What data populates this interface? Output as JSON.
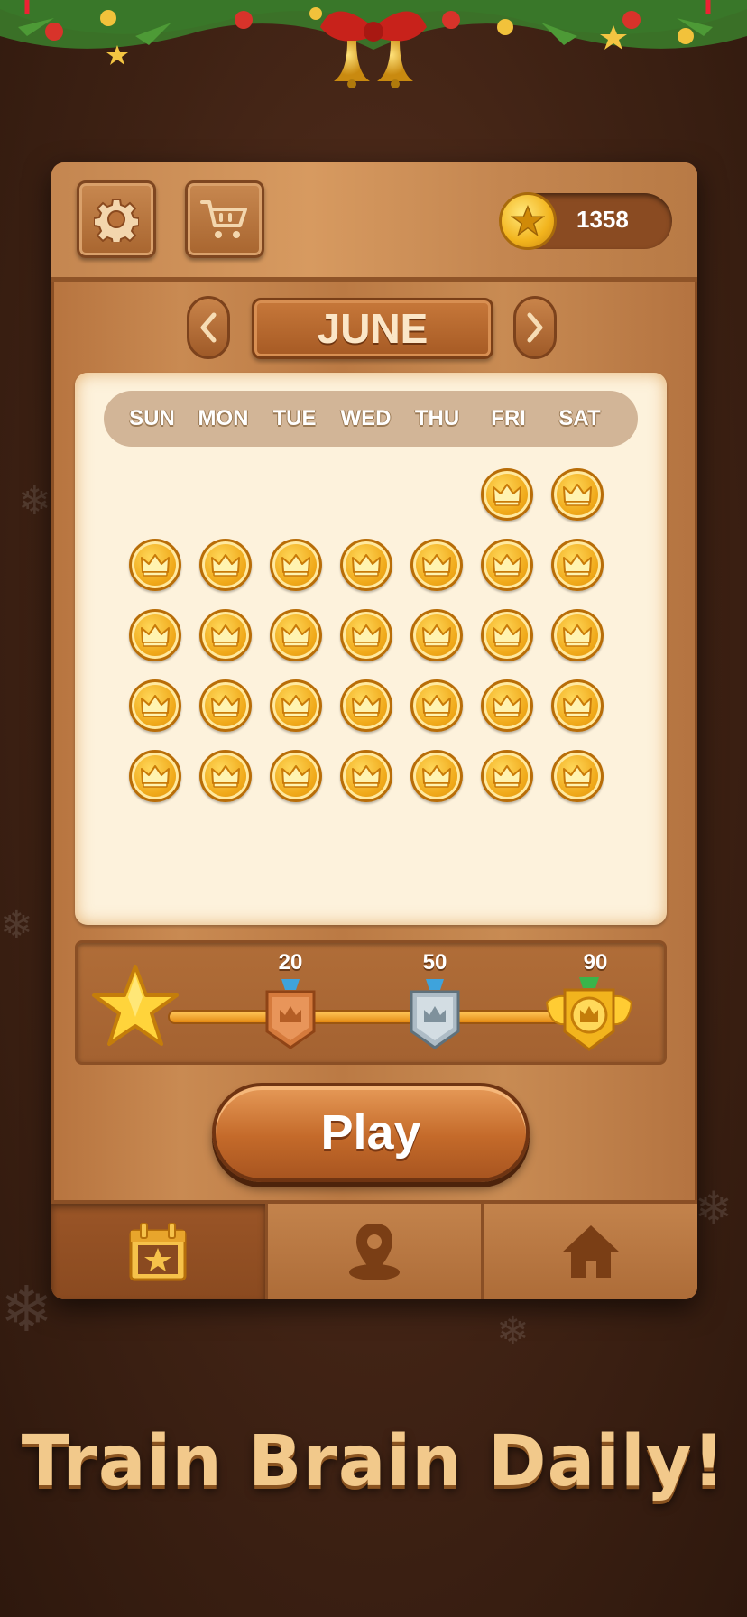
{
  "header": {
    "coins": "1358"
  },
  "calendar": {
    "month": "JUNE",
    "weekdays": [
      "SUN",
      "MON",
      "TUE",
      "WED",
      "THU",
      "FRI",
      "SAT"
    ],
    "completed_days": 30
  },
  "progress": {
    "milestones": [
      "20",
      "50",
      "90"
    ]
  },
  "play_label": "Play",
  "nav": {
    "items": [
      "daily-challenge",
      "map",
      "home"
    ],
    "active": "daily-challenge"
  },
  "tagline": "Train Brain Daily!",
  "icons": {
    "settings": "gear-icon",
    "shop": "cart-icon",
    "coin": "star-coin-icon",
    "prev": "chevron-left-icon",
    "next": "chevron-right-icon",
    "day_complete": "crown-coin-icon"
  },
  "colors": {
    "wood": "#c48650",
    "paper": "#fdf2dc",
    "gold": "#f0a91a",
    "text_light": "#fbe6c7"
  }
}
